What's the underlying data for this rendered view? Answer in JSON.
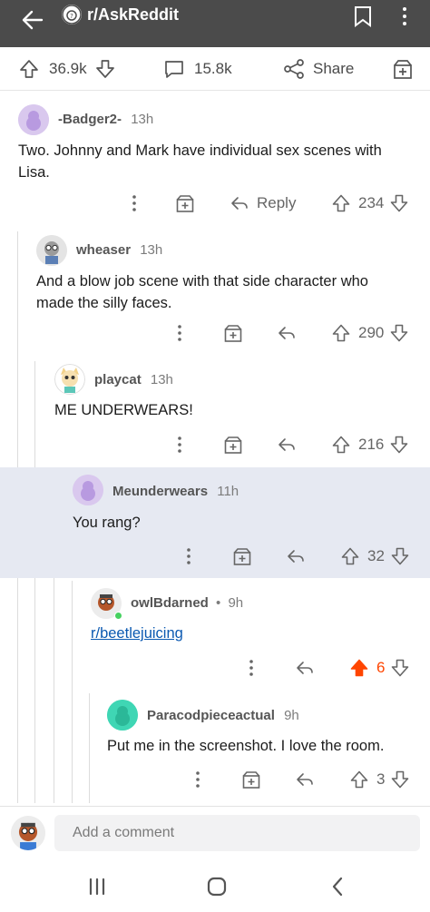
{
  "header": {
    "title": "r/AskReddit"
  },
  "post_actions": {
    "upvotes": "36.9k",
    "comments": "15.8k",
    "share_label": "Share"
  },
  "comments": [
    {
      "user": "-Badger2-",
      "age": "13h",
      "text": "Two. Johnny and Mark have individual sex scenes with Lisa.",
      "reply_label": "Reply",
      "score": "234"
    },
    {
      "user": "wheaser",
      "age": "13h",
      "text": "And a blow job scene with that side character who made the silly faces.",
      "score": "290"
    },
    {
      "user": "playcat",
      "age": "13h",
      "text": "ME UNDERWEARS!",
      "score": "216"
    },
    {
      "user": "Meunderwears",
      "age": "11h",
      "text": "You rang?",
      "score": "32"
    },
    {
      "user": "owlBdarned",
      "separator": "•",
      "age": "9h",
      "text": "r/beetlejuicing",
      "score": "6"
    },
    {
      "user": "Paracodpieceactual",
      "age": "9h",
      "text": "Put me in the screenshot. I love the room.",
      "score": "3"
    }
  ],
  "composer": {
    "placeholder": "Add a comment"
  },
  "colors": {
    "topbar": "#4b4b4b",
    "upvote_active": "#ff4500",
    "highlight": "#e6e9f2",
    "link": "#0b59b1"
  }
}
